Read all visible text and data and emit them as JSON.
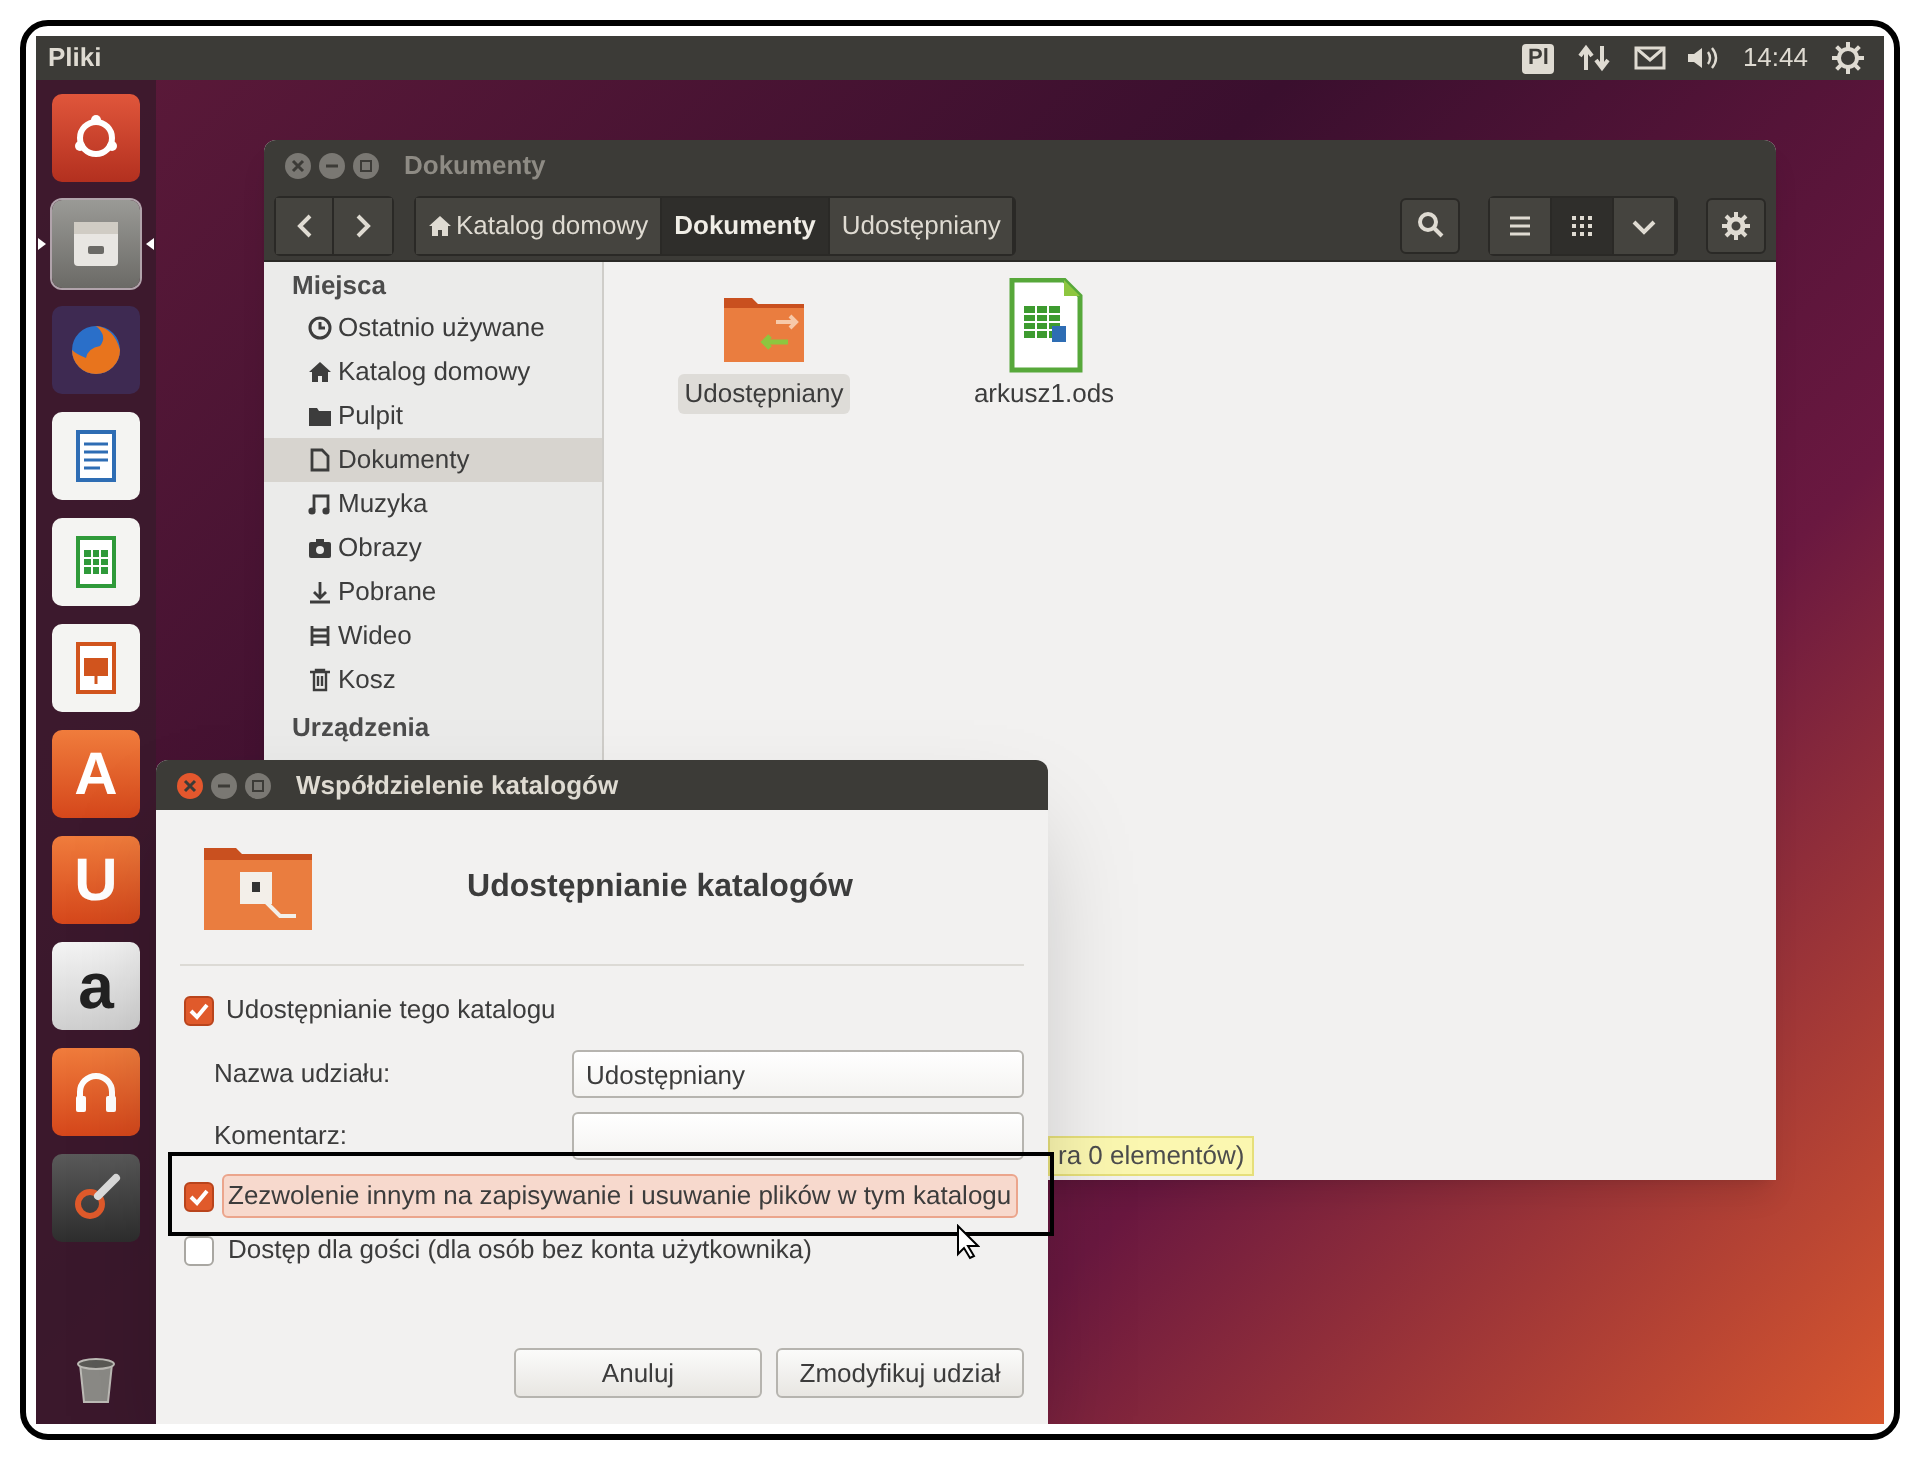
{
  "top_panel": {
    "app_name": "Pliki",
    "keyboard_layout": "Pl",
    "clock": "14:44"
  },
  "launcher": [
    {
      "kind": "ubuntu",
      "running": false
    },
    {
      "kind": "files",
      "running": true
    },
    {
      "kind": "browser",
      "running": false
    },
    {
      "kind": "writer",
      "running": false
    },
    {
      "kind": "calc",
      "running": false
    },
    {
      "kind": "impress",
      "running": false
    },
    {
      "kind": "letter",
      "glyph": "A",
      "running": false
    },
    {
      "kind": "letter",
      "glyph": "U",
      "running": false
    },
    {
      "kind": "amazon",
      "glyph": "a",
      "running": false
    },
    {
      "kind": "music",
      "running": false
    },
    {
      "kind": "settings",
      "running": false
    },
    {
      "kind": "trash",
      "running": false
    }
  ],
  "files_window": {
    "title": "Dokumenty",
    "path": [
      {
        "label": "Katalog domowy",
        "home": true,
        "selected": false
      },
      {
        "label": "Dokumenty",
        "home": false,
        "selected": true
      },
      {
        "label": "Udostępniany",
        "home": false,
        "selected": false
      }
    ],
    "view_buttons": [
      {
        "kind": "list",
        "selected": false
      },
      {
        "kind": "grid",
        "selected": true
      },
      {
        "kind": "dropdown",
        "selected": false
      }
    ],
    "sidebar": [
      {
        "heading": "Miejsca",
        "items": [
          {
            "label": "Ostatnio używane",
            "kind": "clock",
            "selected": false
          },
          {
            "label": "Katalog domowy",
            "kind": "home",
            "selected": false
          },
          {
            "label": "Pulpit",
            "kind": "folder",
            "selected": false
          },
          {
            "label": "Dokumenty",
            "kind": "document",
            "selected": true
          },
          {
            "label": "Muzyka",
            "kind": "music",
            "selected": false
          },
          {
            "label": "Obrazy",
            "kind": "camera",
            "selected": false
          },
          {
            "label": "Pobrane",
            "kind": "download",
            "selected": false
          },
          {
            "label": "Wideo",
            "kind": "film",
            "selected": false
          },
          {
            "label": "Kosz",
            "kind": "trash",
            "selected": false
          }
        ]
      },
      {
        "heading": "Urządzenia"
      }
    ],
    "files": [
      {
        "name": "Udostępniany",
        "kind": "shared-folder",
        "selected": true
      },
      {
        "name": "arkusz1.ods",
        "kind": "spreadsheet",
        "selected": false
      }
    ],
    "status": "ra 0 elementów)"
  },
  "dialog": {
    "title": "Współdzielenie katalogów",
    "heading": "Udostępnianie katalogów",
    "share": {
      "label": "Udostępnianie tego katalogu",
      "checked": true
    },
    "fields": [
      {
        "label": "Nazwa udziału:",
        "value": "Udostępniany"
      },
      {
        "label": "Komentarz:"
      }
    ],
    "options": [
      {
        "label": "Zezwolenie innym na zapisywanie i usuwanie plików w tym katalogu",
        "checked": true,
        "highlighted": true
      },
      {
        "label": "Dostęp dla gości (dla osób bez konta użytkownika)",
        "checked": false,
        "highlighted": false
      }
    ],
    "buttons": [
      "Anuluj",
      "Zmodyfikuj udział"
    ]
  }
}
